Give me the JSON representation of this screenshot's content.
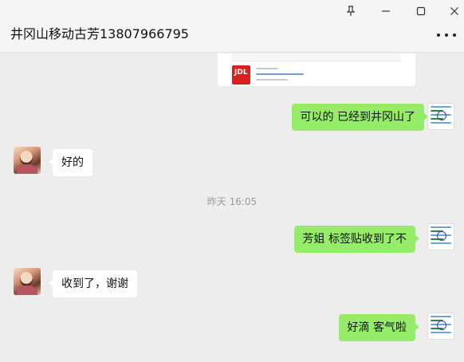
{
  "window": {
    "title": "井冈山移动古芳13807966795"
  },
  "messages": {
    "m1": "可以的 已经到井冈山了",
    "m2": "好的",
    "m3": "芳姐  标签贴收到了不",
    "m4": "收到了，谢谢",
    "m5": "好滴 客气啦"
  },
  "timestamp": "昨天 16:05",
  "colors": {
    "own_bubble": "#95ec69",
    "other_bubble": "#ffffff",
    "chat_background": "#ededed",
    "card_logo": "#d8201f"
  },
  "icons": {
    "pin": "pin-icon",
    "minimize": "minimize-icon",
    "maximize": "maximize-icon",
    "close": "close-icon",
    "more": "more-options-icon"
  }
}
